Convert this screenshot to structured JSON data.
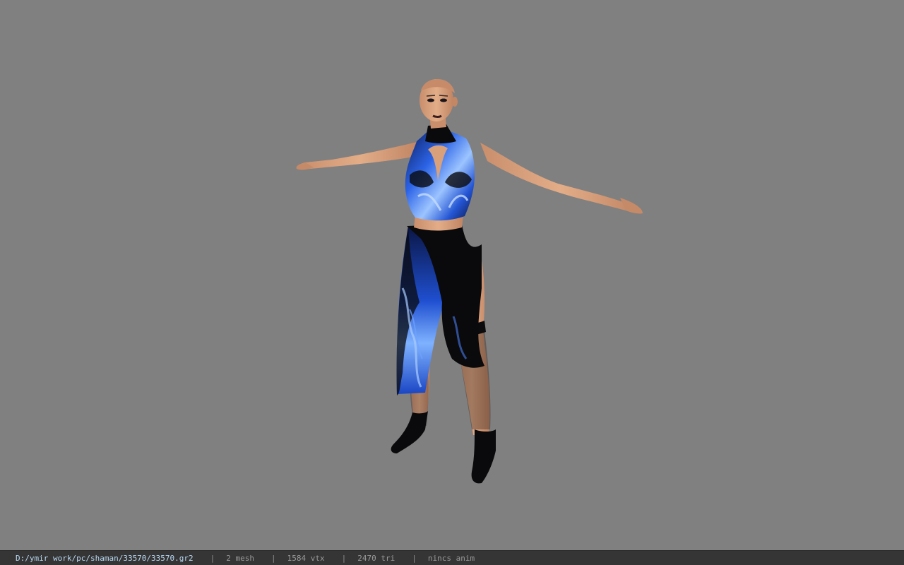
{
  "status_bar": {
    "file_path": "D:/ymir work/pc/shaman/33570/33570.gr2",
    "mesh_count": "2 mesh",
    "vertex_count": "1584 vtx",
    "triangle_count": "2470 tri",
    "animation": "nincs anim",
    "separator": "|"
  },
  "colors": {
    "viewport_background": "#808080",
    "status_bar_background": "#353535",
    "path_text": "#b9d8f2",
    "status_text": "#9a9a9a",
    "skin": "#d9a07c",
    "outfit_black": "#0a0a0c",
    "flame_blue": "#2e6cf0"
  },
  "viewport": {
    "model_description_icon": "character-model-tpose"
  }
}
